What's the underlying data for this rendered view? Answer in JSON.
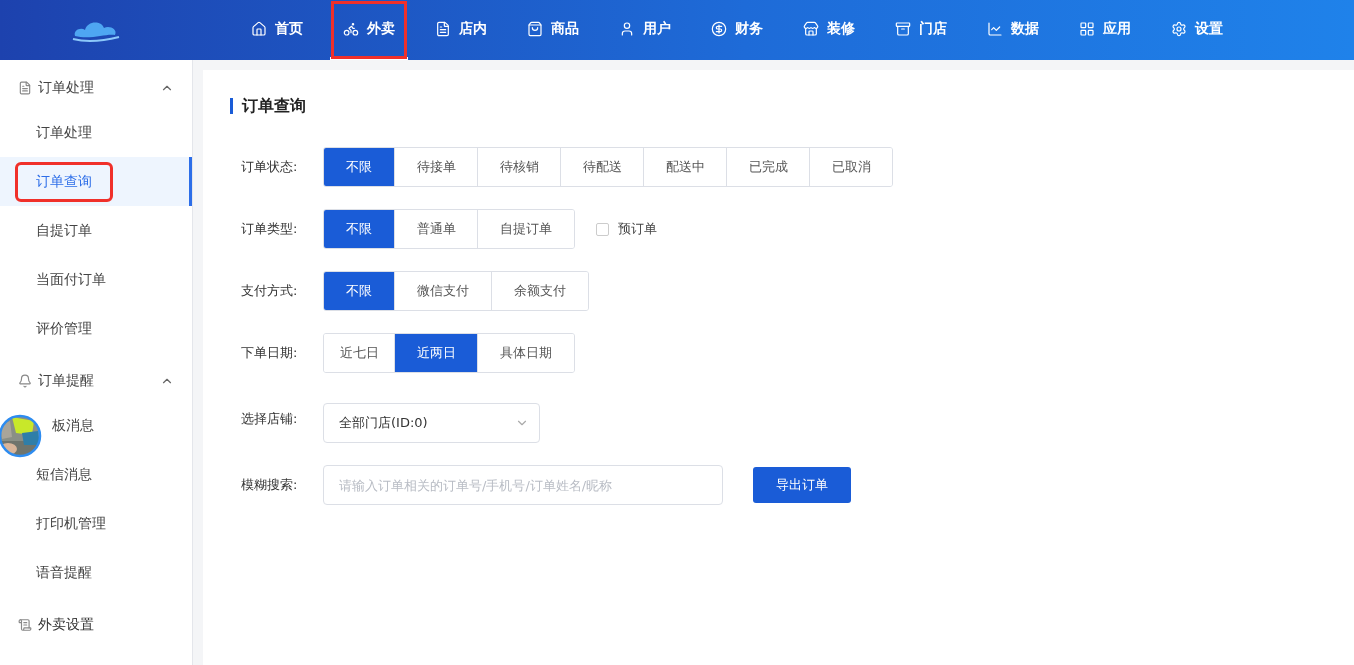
{
  "topnav": [
    {
      "label": "首页",
      "selected": false,
      "highlighted": false
    },
    {
      "label": "外卖",
      "selected": true,
      "highlighted": true
    },
    {
      "label": "店内",
      "selected": false,
      "highlighted": false
    },
    {
      "label": "商品",
      "selected": false,
      "highlighted": false
    },
    {
      "label": "用户",
      "selected": false,
      "highlighted": false
    },
    {
      "label": "财务",
      "selected": false,
      "highlighted": false
    },
    {
      "label": "装修",
      "selected": false,
      "highlighted": false
    },
    {
      "label": "门店",
      "selected": false,
      "highlighted": false
    },
    {
      "label": "数据",
      "selected": false,
      "highlighted": false
    },
    {
      "label": "应用",
      "selected": false,
      "highlighted": false
    },
    {
      "label": "设置",
      "selected": false,
      "highlighted": false
    }
  ],
  "sidebar": {
    "groups": [
      {
        "label": "订单处理",
        "expanded": true,
        "children": [
          {
            "label": "订单处理",
            "selected": false,
            "highlighted": false,
            "covered": false
          },
          {
            "label": "订单查询",
            "selected": true,
            "highlighted": true,
            "covered": false
          },
          {
            "label": "自提订单",
            "selected": false,
            "highlighted": false,
            "covered": false
          },
          {
            "label": "当面付订单",
            "selected": false,
            "highlighted": false,
            "covered": false
          },
          {
            "label": "评价管理",
            "selected": false,
            "highlighted": false,
            "covered": false
          }
        ]
      },
      {
        "label": "订单提醒",
        "expanded": true,
        "children": [
          {
            "label": "板消息",
            "selected": false,
            "highlighted": false,
            "covered": true
          },
          {
            "label": "短信消息",
            "selected": false,
            "highlighted": false,
            "covered": false
          },
          {
            "label": "打印机管理",
            "selected": false,
            "highlighted": false,
            "covered": false
          },
          {
            "label": "语音提醒",
            "selected": false,
            "highlighted": false,
            "covered": false
          }
        ]
      },
      {
        "label": "外卖设置"
      }
    ]
  },
  "page_title": "订单查询",
  "filters": [
    {
      "label": "订单状态:",
      "kind": "segments",
      "options": [
        {
          "label": "不限",
          "selected": true
        },
        {
          "label": "待接单",
          "selected": false
        },
        {
          "label": "待核销",
          "selected": false
        },
        {
          "label": "待配送",
          "selected": false
        },
        {
          "label": "配送中",
          "selected": false
        },
        {
          "label": "已完成",
          "selected": false
        },
        {
          "label": "已取消",
          "selected": false
        }
      ]
    },
    {
      "label": "订单类型:",
      "kind": "segments",
      "options": [
        {
          "label": "不限",
          "selected": true
        },
        {
          "label": "普通单",
          "selected": false
        },
        {
          "label": "自提订单",
          "selected": false
        }
      ],
      "checkbox": {
        "label": "预订单",
        "checked": false
      }
    },
    {
      "label": "支付方式:",
      "kind": "segments",
      "options": [
        {
          "label": "不限",
          "selected": true
        },
        {
          "label": "微信支付",
          "selected": false
        },
        {
          "label": "余额支付",
          "selected": false
        }
      ]
    },
    {
      "label": "下单日期:",
      "kind": "segments",
      "options": [
        {
          "label": "近七日",
          "selected": false
        },
        {
          "label": "近两日",
          "selected": true
        },
        {
          "label": "具体日期",
          "selected": false
        }
      ]
    },
    {
      "label": "选择店铺:",
      "kind": "select",
      "value": "全部门店(ID:0)"
    },
    {
      "label": "模糊搜索:",
      "kind": "search",
      "placeholder": "请输入订单相关的订单号/手机号/订单姓名/昵称",
      "button": "导出订单"
    }
  ]
}
